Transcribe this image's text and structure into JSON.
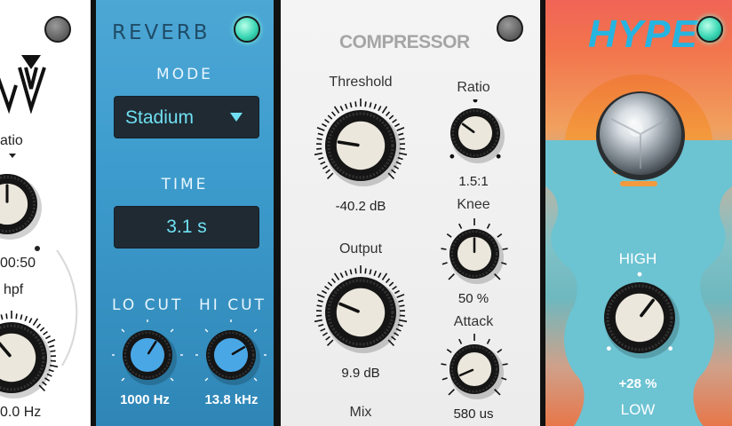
{
  "colors": {
    "reverb_bg": "#3d9ccd",
    "display_text": "#6fe0f2",
    "led_on": "#3ad7b4",
    "led_off": "#7a7a7a",
    "hype_title": "#26b4e0",
    "knob_blue": "#4aa7e6"
  },
  "icons": {
    "dropdown": "triangle-down-icon"
  },
  "left_partial": {
    "ratio_label": "atio",
    "ratio_value": "00:50",
    "hpf_label": "hpf",
    "hpf_value": "0.0 Hz"
  },
  "reverb": {
    "title": "REVERB",
    "mode_label": "MODE",
    "mode_value": "Stadium",
    "time_label": "TIME",
    "time_value": "3.1 s",
    "lo_cut_label": "LO CUT",
    "lo_cut_value": "1000 Hz",
    "lo_cut_level": 0.62,
    "hi_cut_label": "HI CUT",
    "hi_cut_value": "13.8 kHz",
    "hi_cut_level": 0.72
  },
  "compressor": {
    "title": "COMPRESSOR",
    "threshold_label": "Threshold",
    "threshold_value": "-40.2 dB",
    "threshold_level": 0.2,
    "ratio_label": "Ratio",
    "ratio_value": "1.5:1",
    "ratio_level": 0.3,
    "output_label": "Output",
    "output_value": "9.9 dB",
    "output_level": 0.25,
    "knee_label": "Knee",
    "knee_value": "50 %",
    "knee_level": 0.5,
    "attack_label": "Attack",
    "attack_value": "580 us",
    "attack_level": 0.08,
    "mix_label": "Mix"
  },
  "hype": {
    "title": "HYPE",
    "high_label": "HIGH",
    "high_value": "+28 %",
    "high_level": 0.64,
    "low_label": "LOW"
  }
}
